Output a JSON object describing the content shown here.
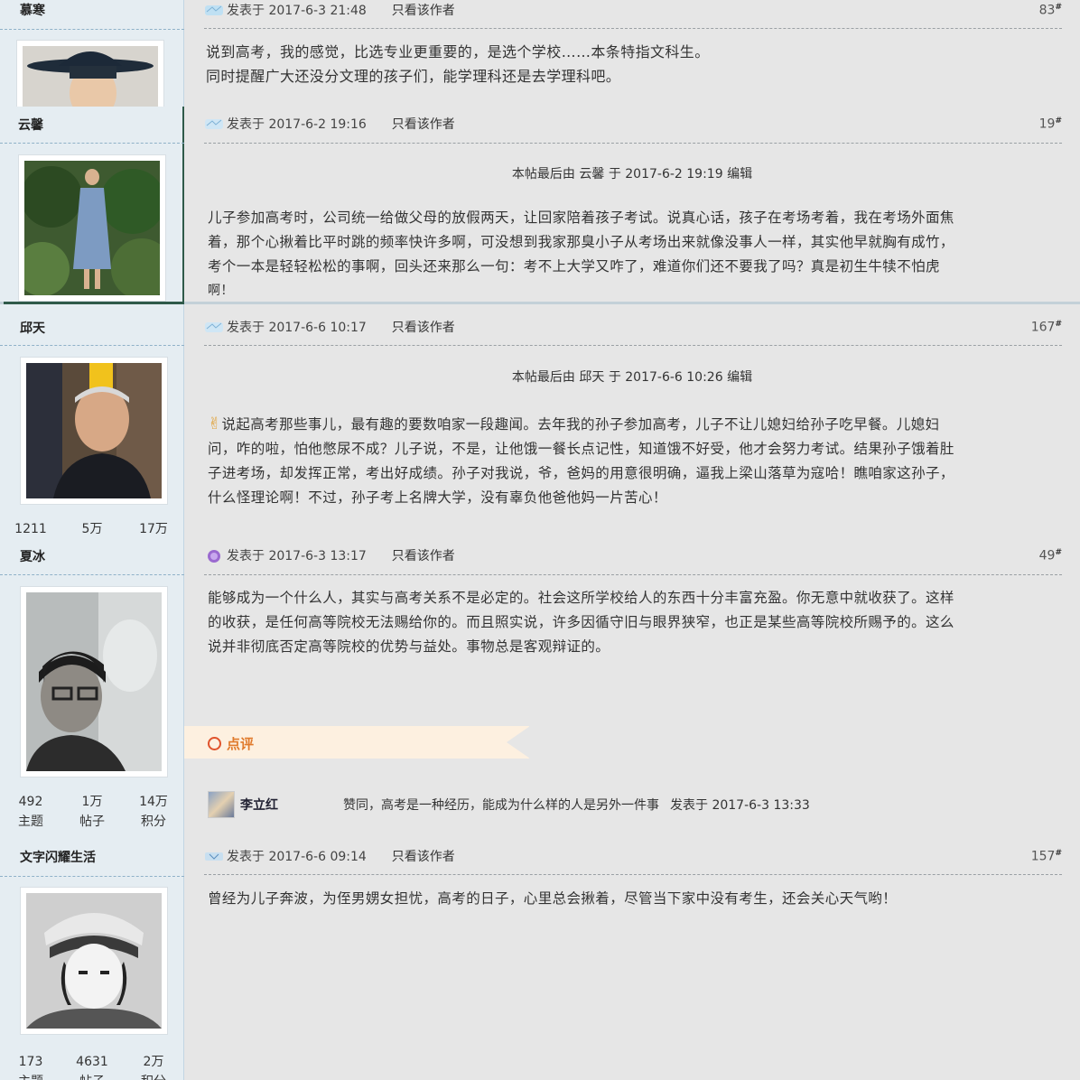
{
  "posts": [
    {
      "username": "慕寒",
      "date": "发表于 2017-6-3 21:48",
      "author_only": "只看该作者",
      "floor": "83",
      "floor_mark": "#",
      "lines": [
        "说到高考，我的感觉，比选专业更重要的，是选个学校……本条特指文科生。",
        "同时提醒广大还没分文理的孩子们，能学理科还是去学理科吧。"
      ]
    },
    {
      "username": "云馨",
      "date": "发表于 2017-6-2 19:16",
      "author_only": "只看该作者",
      "floor": "19",
      "floor_mark": "#",
      "edited": "本帖最后由 云馨 于 2017-6-2 19:19 编辑",
      "lines": [
        "儿子参加高考时，公司统一给做父母的放假两天，让回家陪着孩子考试。说真心话，孩子在考场考着，我在考场外面焦",
        "着，那个心揪着比平时跳的频率快许多啊，可没想到我家那臭小子从考场出来就像没事人一样，其实他早就胸有成竹，",
        "考个一本是轻轻松松的事啊，回头还来那么一句：考不上大学又咋了，难道你们还不要我了吗？真是初生牛犊不怕虎",
        "啊！"
      ]
    },
    {
      "username": "邱天",
      "date": "发表于 2017-6-6 10:17",
      "author_only": "只看该作者",
      "floor": "167",
      "floor_mark": "#",
      "edited": "本帖最后由 邱天 于 2017-6-6 10:26 编辑",
      "emoji": "✌",
      "lines": [
        "说起高考那些事儿，最有趣的要数咱家一段趣闻。去年我的孙子参加高考，儿子不让儿媳妇给孙子吃早餐。儿媳妇",
        "问，咋的啦，怕他憋尿不成？儿子说，不是，让他饿一餐长点记性，知道饿不好受，他才会努力考试。结果孙子饿着肚",
        "子进考场，却发挥正常，考出好成绩。孙子对我说，爷，爸妈的用意很明确，逼我上梁山落草为寇哈！瞧咱家这孙子，",
        "什么怪理论啊！不过，孙子考上名牌大学，没有辜负他爸他妈一片苦心！"
      ],
      "stats": [
        "1211",
        "5万",
        "17万"
      ]
    },
    {
      "username": "夏冰",
      "date": "发表于 2017-6-3 13:17",
      "author_only": "只看该作者",
      "floor": "49",
      "floor_mark": "#",
      "lines": [
        "能够成为一个什么人，其实与高考关系不是必定的。社会这所学校给人的东西十分丰富充盈。你无意中就收获了。这样",
        "的收获，是任何高等院校无法赐给你的。而且照实说，许多因循守旧与眼界狭窄，也正是某些高等院校所赐予的。这么",
        "说并非彻底否定高等院校的优势与益处。事物总是客观辩证的。"
      ],
      "stats": [
        "492",
        "1万",
        "14万"
      ],
      "stat_labels": [
        "主题",
        "帖子",
        "积分"
      ],
      "comment_label": "点评",
      "comment": {
        "user": "李立红",
        "text": "赞同，高考是一种经历，能成为什么样的人是另外一件事",
        "date": "发表于 2017-6-3 13:33"
      }
    },
    {
      "username": "文字闪耀生活",
      "date": "发表于 2017-6-6 09:14",
      "author_only": "只看该作者",
      "floor": "157",
      "floor_mark": "#",
      "lines": [
        "曾经为儿子奔波，为侄男娚女担忧，高考的日子，心里总会揪着，尽管当下家中没有考生，还会关心天气哟！"
      ],
      "stats": [
        "173",
        "4631",
        "2万"
      ],
      "stat_labels": [
        "主题",
        "帖子",
        "积分"
      ]
    }
  ]
}
